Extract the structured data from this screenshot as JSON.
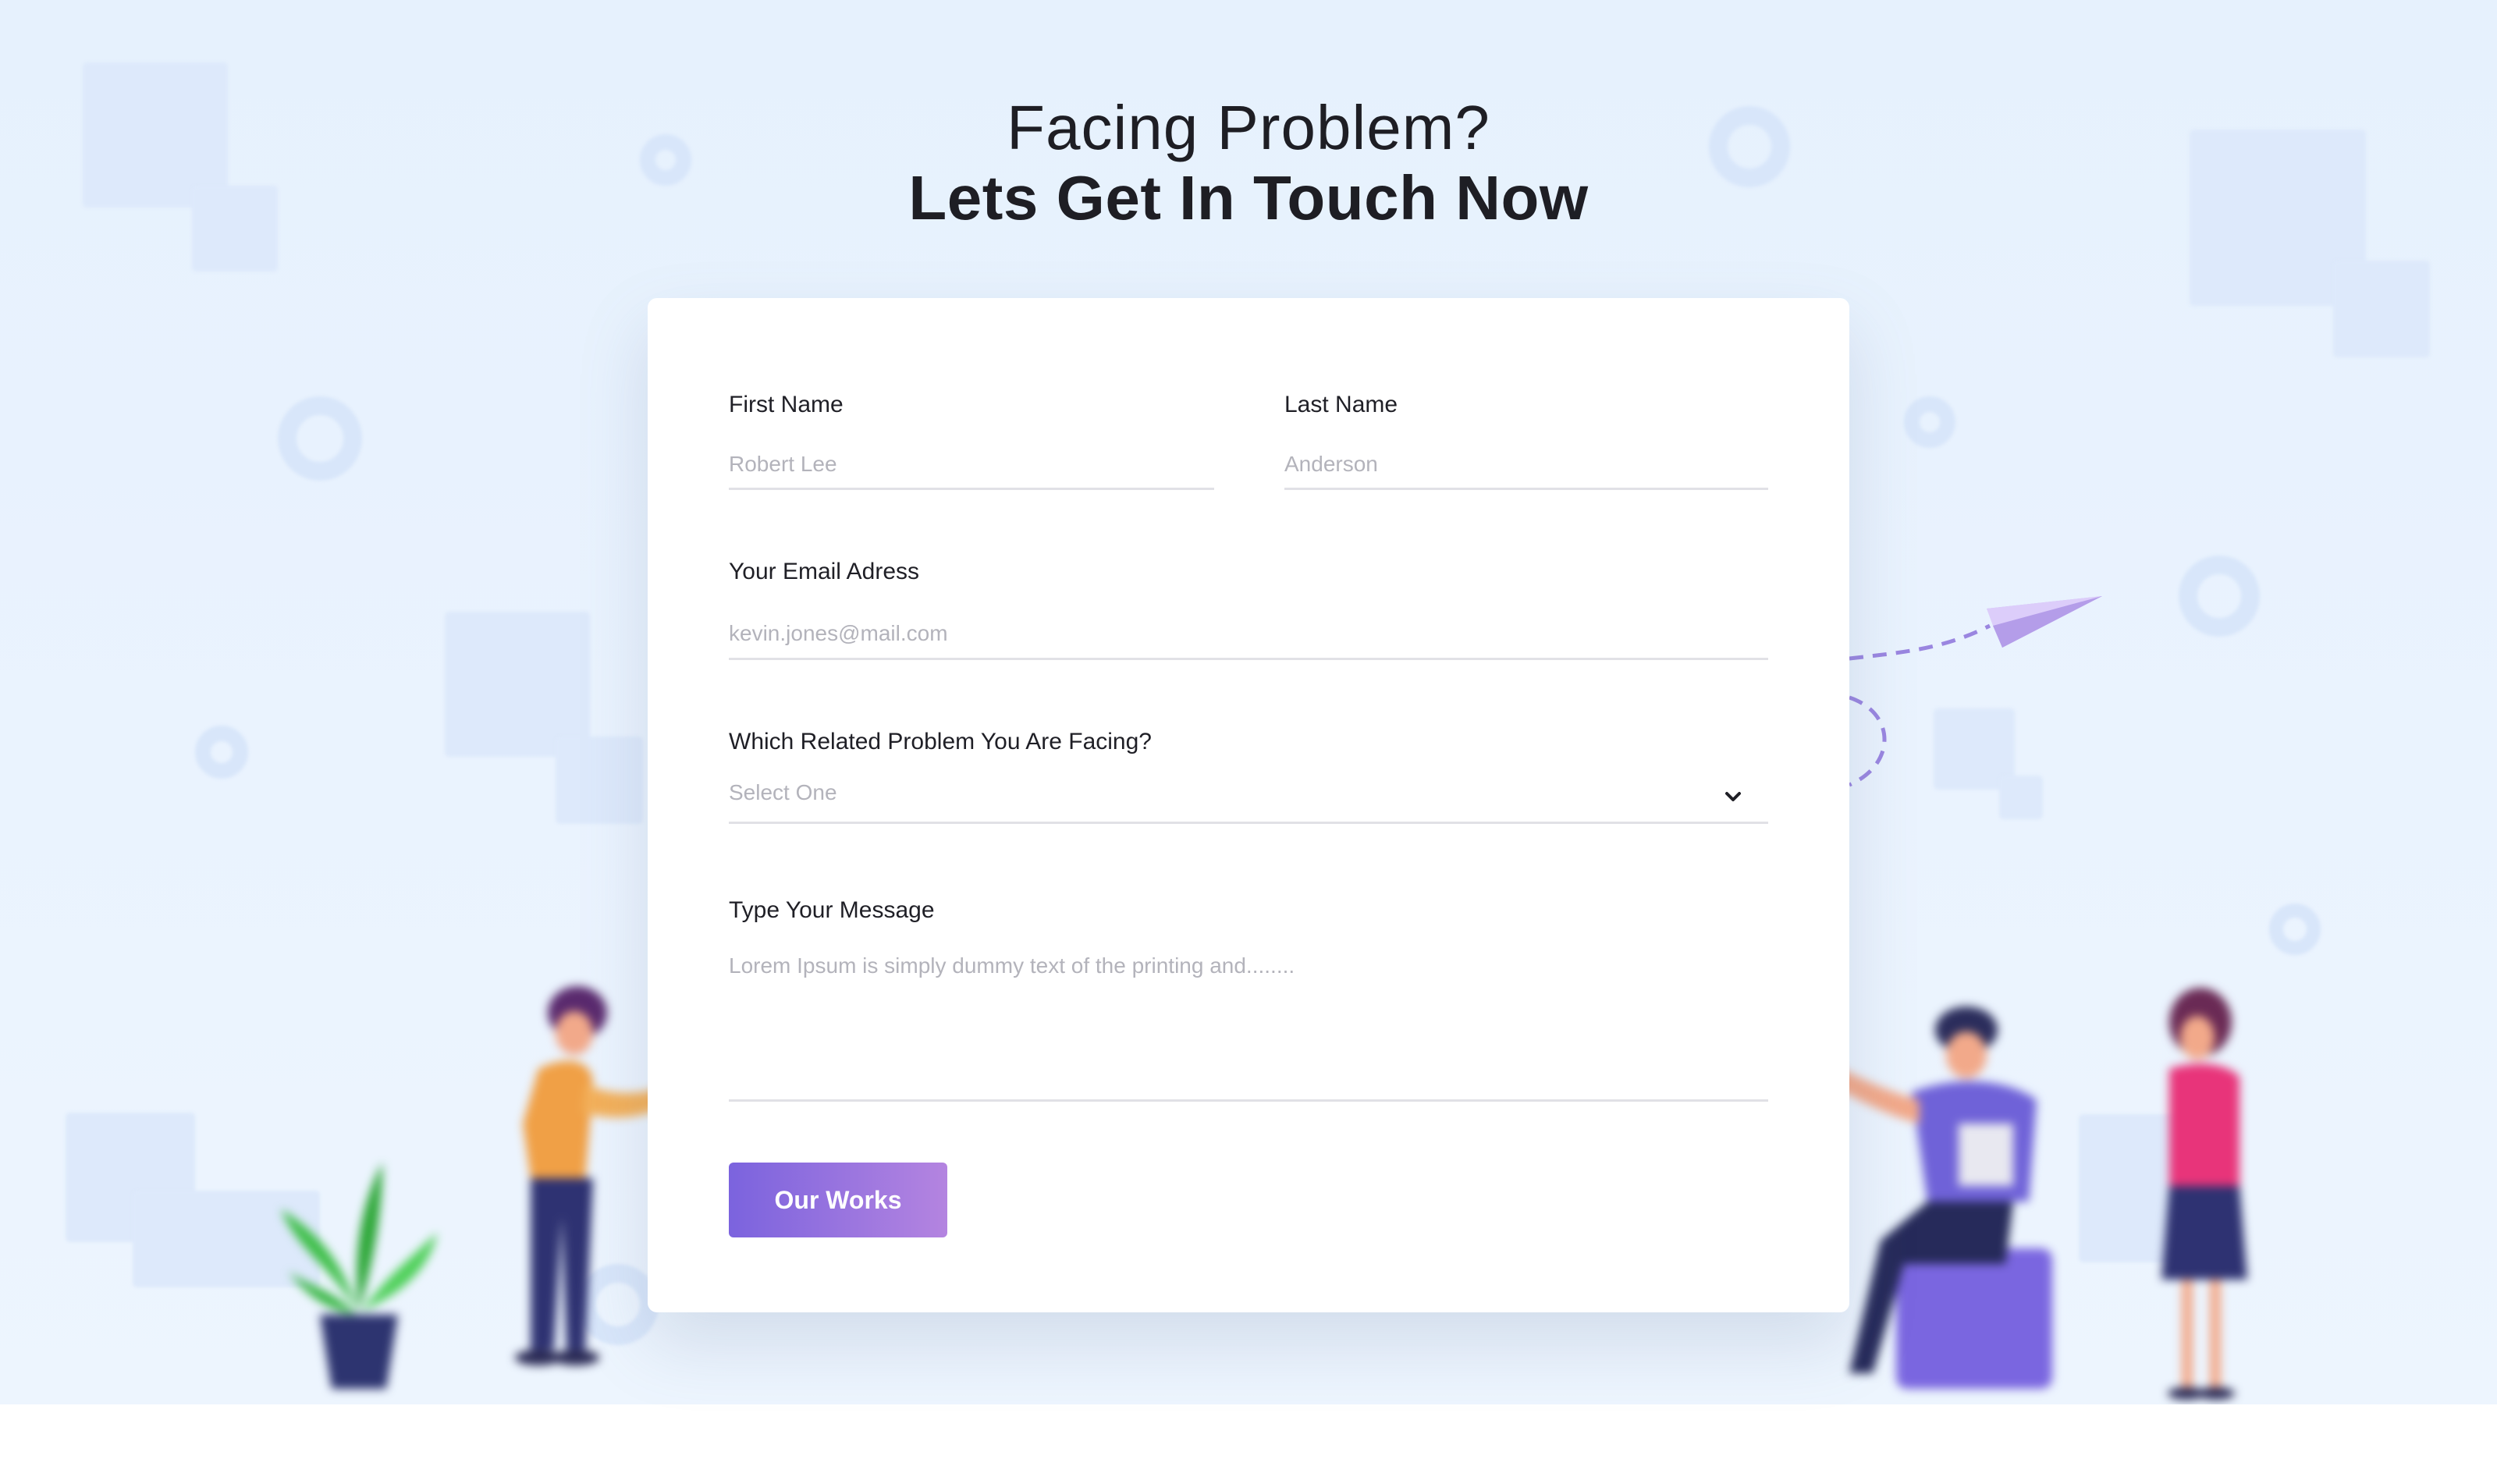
{
  "header": {
    "subtitle": "Facing Problem?",
    "title": "Lets Get In Touch Now"
  },
  "form": {
    "first_name": {
      "label": "First Name",
      "placeholder": "Robert Lee"
    },
    "last_name": {
      "label": "Last Name",
      "placeholder": "Anderson"
    },
    "email": {
      "label": "Your Email Adress",
      "placeholder": "kevin.jones@mail.com"
    },
    "problem": {
      "label": "Which Related Problem You Are Facing?",
      "selected": "Select One",
      "icon": "chevron-down-icon"
    },
    "message": {
      "label": "Type Your Message",
      "placeholder": "Lorem Ipsum is simply dummy text of the printing and........"
    },
    "submit_label": "Our Works"
  },
  "colors": {
    "accent_start": "#7b63de",
    "accent_end": "#b484e0",
    "background": "#e6f1fd",
    "text": "#1e1e24",
    "placeholder": "#b3b3bb"
  },
  "illustrations": [
    "paper-plane-icon",
    "plant-illustration",
    "person-standing-illustration",
    "person-sitting-illustration",
    "woman-standing-illustration"
  ]
}
